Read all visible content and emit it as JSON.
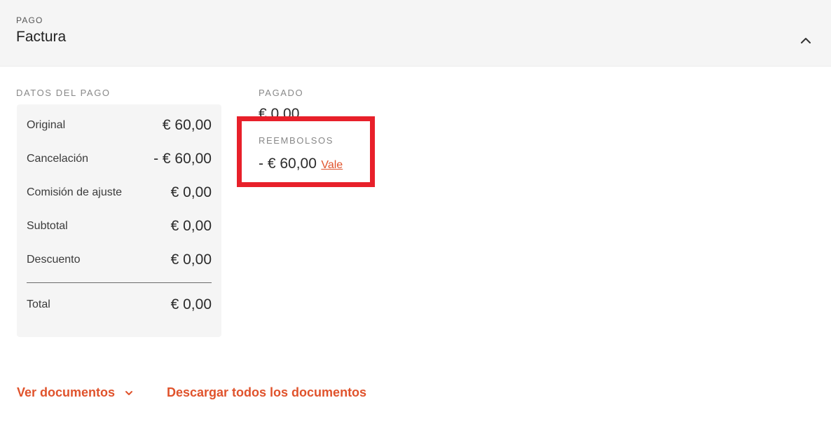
{
  "header": {
    "eyebrow": "PAGO",
    "title": "Factura"
  },
  "payment_data": {
    "label": "DATOS DEL PAGO",
    "rows": [
      {
        "label": "Original",
        "value": "€ 60,00"
      },
      {
        "label": "Cancelación",
        "value": "- € 60,00"
      },
      {
        "label": "Comisión de ajuste",
        "value": "€ 0,00"
      },
      {
        "label": "Subtotal",
        "value": "€ 0,00"
      },
      {
        "label": "Descuento",
        "value": "€ 0,00"
      }
    ],
    "total": {
      "label": "Total",
      "value": "€ 0,00"
    }
  },
  "paid": {
    "label": "PAGADO",
    "value": "€ 0,00"
  },
  "refunds": {
    "label": "REEMBOLSOS",
    "value": "- € 60,00",
    "link": "Vale"
  },
  "footer": {
    "view_documents": "Ver documentos",
    "download_all": "Descargar todos los documentos"
  },
  "colors": {
    "accent": "#e0532c",
    "highlight": "#e8202a",
    "card_bg": "#f5f5f5"
  }
}
